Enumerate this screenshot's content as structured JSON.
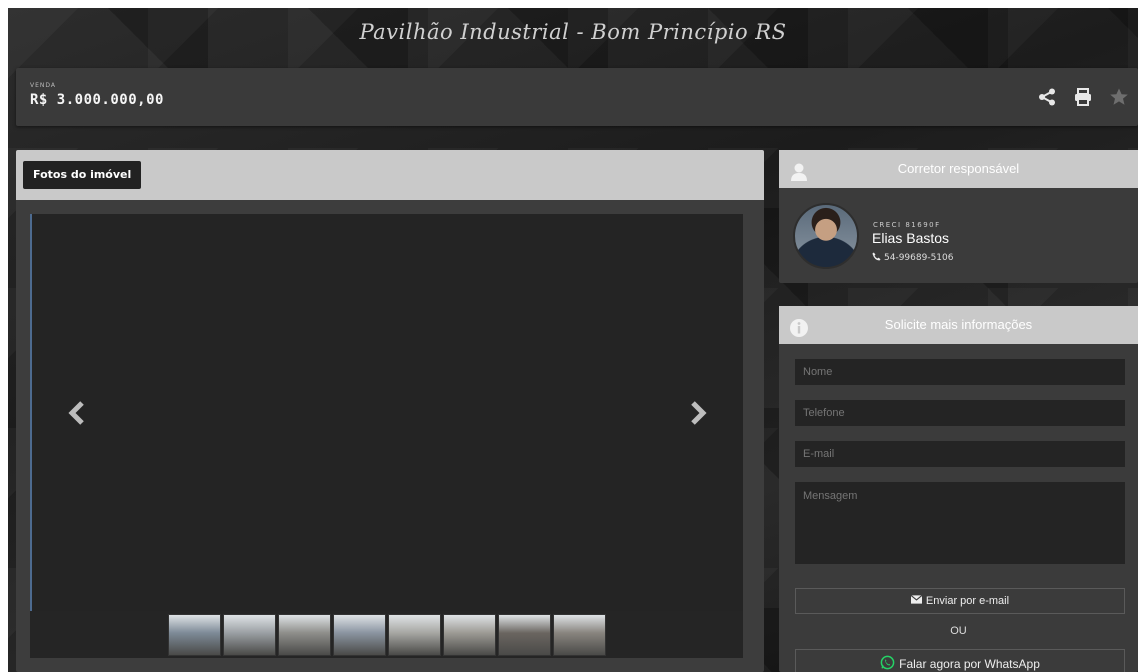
{
  "header": {
    "title": "Pavilhão Industrial - Bom Princípio RS"
  },
  "price": {
    "label": "VENDA",
    "value": "R$ 3.000.000,00"
  },
  "actions": {
    "share_icon": "share-icon",
    "print_icon": "print-icon",
    "favorite_icon": "star-icon"
  },
  "gallery": {
    "tab_label": "Fotos do imóvel",
    "prev_icon": "chevron-left-icon",
    "next_icon": "chevron-right-icon",
    "thumbnails": [
      {
        "tone": "#7d8a97"
      },
      {
        "tone": "#9a9fa3"
      },
      {
        "tone": "#8e8e8a"
      },
      {
        "tone": "#8a94a0"
      },
      {
        "tone": "#a6a6a2"
      },
      {
        "tone": "#9c9a94"
      },
      {
        "tone": "#6a6560"
      },
      {
        "tone": "#88847e"
      }
    ]
  },
  "agent": {
    "title": "Corretor responsável",
    "creci": "CRECI 81690F",
    "name": "Elias Bastos",
    "phone": "54-99689-5106"
  },
  "contact": {
    "title": "Solicite mais informações",
    "name_placeholder": "Nome",
    "phone_placeholder": "Telefone",
    "email_placeholder": "E-mail",
    "message_placeholder": "Mensagem",
    "send_label": "Enviar por e-mail",
    "or_label": "OU",
    "whatsapp_label": "Falar agora por WhatsApp"
  },
  "colors": {
    "whatsapp": "#25d366",
    "panel": "#3b3b3b",
    "header_gray": "#c9c9c9"
  }
}
